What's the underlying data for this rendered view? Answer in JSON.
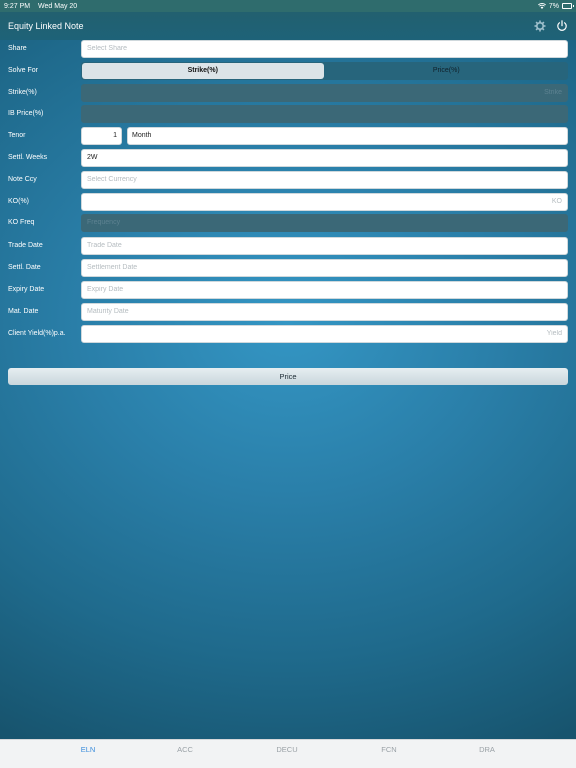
{
  "status_bar": {
    "time": "9:27 PM",
    "date": "Wed May 20",
    "battery": "7%"
  },
  "header": {
    "title": "Equity Linked Note"
  },
  "form": {
    "share": {
      "label": "Share",
      "placeholder": "Select Share"
    },
    "solve_for": {
      "label": "Solve For",
      "options": [
        "Strike(%)",
        "Price(%)"
      ],
      "selected": "Strike(%)"
    },
    "strike": {
      "label": "Strike(%)",
      "placeholder": "Strike"
    },
    "ib_price": {
      "label": "IB Price(%)",
      "placeholder": ""
    },
    "tenor": {
      "label": "Tenor",
      "value": "1",
      "unit": "Month"
    },
    "settl_weeks": {
      "label": "Settl. Weeks",
      "value": "2W"
    },
    "note_ccy": {
      "label": "Note Ccy",
      "placeholder": "Select Currency"
    },
    "ko": {
      "label": "KO(%)",
      "placeholder": "KO"
    },
    "ko_freq": {
      "label": "KO Freq",
      "placeholder": "Frequency"
    },
    "trade_date": {
      "label": "Trade Date",
      "placeholder": "Trade Date"
    },
    "settl_date": {
      "label": "Settl. Date",
      "placeholder": "Settlement Date"
    },
    "expiry_date": {
      "label": "Expiry Date",
      "placeholder": "Expiry Date"
    },
    "mat_date": {
      "label": "Mat. Date",
      "placeholder": "Maturity Date"
    },
    "client_yield": {
      "label": "Client Yield(%)p.a.",
      "placeholder": "Yield"
    }
  },
  "price_button": {
    "label": "Price"
  },
  "tabs": [
    {
      "label": "ELN",
      "active": true
    },
    {
      "label": "ACC",
      "active": false
    },
    {
      "label": "DECU",
      "active": false
    },
    {
      "label": "FCN",
      "active": false
    },
    {
      "label": "DRA",
      "active": false
    }
  ],
  "colors": {
    "accent": "#3b8ddc",
    "status_bar": "#2f6c6d",
    "background": "#2a7fa9"
  }
}
